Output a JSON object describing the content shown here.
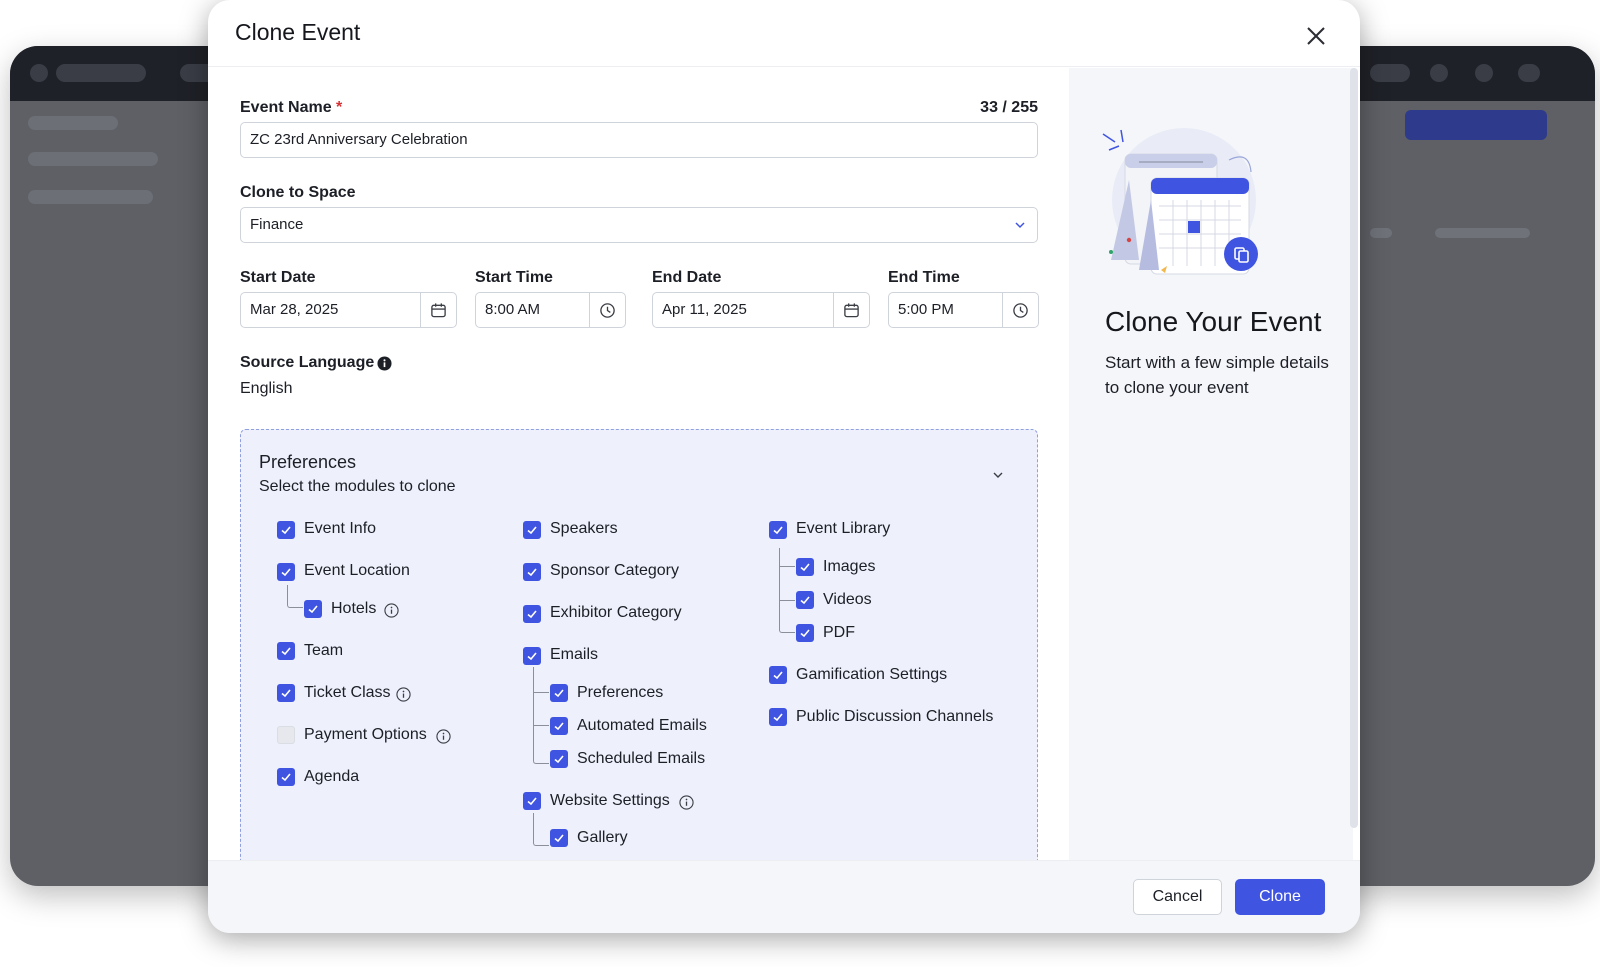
{
  "modal": {
    "title": "Clone Event"
  },
  "form": {
    "event_name": {
      "label": "Event Name",
      "required_mark": "*",
      "counter": "33 / 255",
      "value": "ZC 23rd Anniversary Celebration"
    },
    "clone_to_space": {
      "label": "Clone to Space",
      "value": "Finance"
    },
    "start_date": {
      "label": "Start Date",
      "value": "Mar 28, 2025"
    },
    "start_time": {
      "label": "Start Time",
      "value": "8:00 AM"
    },
    "end_date": {
      "label": "End Date",
      "value": "Apr 11, 2025"
    },
    "end_time": {
      "label": "End Time",
      "value": "5:00 PM"
    },
    "source_language": {
      "label": "Source Language",
      "value": "English"
    }
  },
  "preferences": {
    "title": "Preferences",
    "subtitle": "Select the modules to clone",
    "col1": {
      "event_info": "Event Info",
      "event_location": "Event Location",
      "hotels": "Hotels",
      "team": "Team",
      "ticket_class": "Ticket Class",
      "payment_options": "Payment Options",
      "agenda": "Agenda"
    },
    "col2": {
      "speakers": "Speakers",
      "sponsor_category": "Sponsor Category",
      "exhibitor_category": "Exhibitor Category",
      "emails": "Emails",
      "preferences": "Preferences",
      "automated_emails": "Automated Emails",
      "scheduled_emails": "Scheduled Emails",
      "website_settings": "Website Settings",
      "gallery": "Gallery"
    },
    "col3": {
      "event_library": "Event Library",
      "images": "Images",
      "videos": "Videos",
      "pdf": "PDF",
      "gamification_settings": "Gamification Settings",
      "public_discussion_channels": "Public Discussion Channels"
    },
    "checked_color": "#3f54e0",
    "unchecked": [
      "Payment Options"
    ]
  },
  "side_panel": {
    "title": "Clone Your Event",
    "description": "Start with a few simple details to clone your event"
  },
  "footer": {
    "cancel_label": "Cancel",
    "clone_label": "Clone"
  },
  "icons": {
    "close": "close-icon",
    "calendar": "calendar-icon",
    "clock": "clock-icon",
    "chevron": "chevron-down-icon",
    "info": "info-icon",
    "check": "check-icon"
  }
}
